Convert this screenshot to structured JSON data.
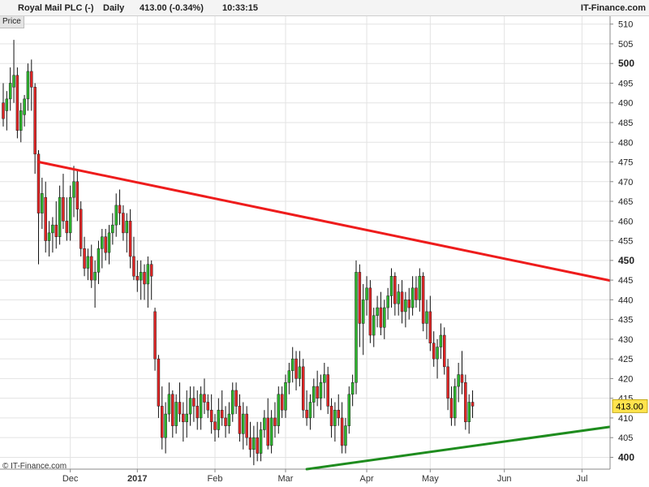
{
  "header": {
    "instrument": "Royal Mail PLC (-)",
    "period": "Daily",
    "quote": "413.00 (-0.34%)",
    "time": "10:33:15",
    "brand": "IT-Finance.com"
  },
  "price_tab": "Price",
  "footer": "© IT-Finance.com",
  "colors": {
    "up": "#2db52d",
    "down": "#e02525",
    "resistance": "#ee1c1c",
    "support": "#1e8c1e",
    "grid": "#e3e3e3",
    "axis": "#888888",
    "last_price_bg": "#ffe34d"
  },
  "chart_data": {
    "type": "candlestick",
    "title": "Royal Mail PLC (-)",
    "xlabel": "",
    "ylabel": "",
    "ylim": [
      397,
      512
    ],
    "grid": true,
    "y_ticks": [
      {
        "value": 400,
        "label": "400",
        "bold": true
      },
      {
        "value": 405,
        "label": "405",
        "bold": false
      },
      {
        "value": 410,
        "label": "410",
        "bold": false
      },
      {
        "value": 415,
        "label": "415",
        "bold": false
      },
      {
        "value": 420,
        "label": "420",
        "bold": false
      },
      {
        "value": 425,
        "label": "425",
        "bold": false
      },
      {
        "value": 430,
        "label": "430",
        "bold": false
      },
      {
        "value": 435,
        "label": "435",
        "bold": false
      },
      {
        "value": 440,
        "label": "440",
        "bold": false
      },
      {
        "value": 445,
        "label": "445",
        "bold": false
      },
      {
        "value": 450,
        "label": "450",
        "bold": true
      },
      {
        "value": 455,
        "label": "455",
        "bold": false
      },
      {
        "value": 460,
        "label": "460",
        "bold": false
      },
      {
        "value": 465,
        "label": "465",
        "bold": false
      },
      {
        "value": 470,
        "label": "470",
        "bold": false
      },
      {
        "value": 475,
        "label": "475",
        "bold": false
      },
      {
        "value": 480,
        "label": "480",
        "bold": false
      },
      {
        "value": 485,
        "label": "485",
        "bold": false
      },
      {
        "value": 490,
        "label": "490",
        "bold": false
      },
      {
        "value": 495,
        "label": "495",
        "bold": false
      },
      {
        "value": 500,
        "label": "500",
        "bold": true
      },
      {
        "value": 505,
        "label": "505",
        "bold": false
      },
      {
        "value": 510,
        "label": "510",
        "bold": false
      }
    ],
    "x_ticks": [
      {
        "index": 19,
        "label": "Dec",
        "bold": false
      },
      {
        "index": 38,
        "label": "2017",
        "bold": true
      },
      {
        "index": 60,
        "label": "Feb",
        "bold": false
      },
      {
        "index": 80,
        "label": "Mar",
        "bold": false
      },
      {
        "index": 103,
        "label": "Apr",
        "bold": false
      },
      {
        "index": 121,
        "label": "May",
        "bold": false
      },
      {
        "index": 142,
        "label": "Jun",
        "bold": false
      },
      {
        "index": 164,
        "label": "Jul",
        "bold": false
      }
    ],
    "last_price": {
      "value": 413.0,
      "label": "413.00"
    },
    "trendlines": [
      {
        "name": "resistance",
        "from": {
          "index": 10,
          "value": 475
        },
        "to": {
          "index": 174,
          "value": 444.5
        }
      },
      {
        "name": "support",
        "from": {
          "index": 86,
          "value": 397
        },
        "to": {
          "index": 174,
          "value": 408
        }
      }
    ],
    "candles": [
      [
        490,
        495,
        484,
        486
      ],
      [
        488,
        493,
        483,
        491
      ],
      [
        491,
        499,
        488,
        495
      ],
      [
        494,
        506,
        490,
        497
      ],
      [
        497,
        499,
        481,
        483
      ],
      [
        483,
        490,
        480,
        488
      ],
      [
        487,
        492,
        484,
        491
      ],
      [
        491,
        500,
        488,
        498
      ],
      [
        498,
        501,
        488,
        494
      ],
      [
        494,
        495,
        472,
        477
      ],
      [
        477,
        478,
        449,
        462
      ],
      [
        462,
        471,
        458,
        467
      ],
      [
        466,
        470,
        452,
        455
      ],
      [
        455,
        460,
        451,
        457
      ],
      [
        457,
        461,
        452,
        459
      ],
      [
        459,
        465,
        453,
        456
      ],
      [
        456,
        469,
        454,
        466
      ],
      [
        466,
        472,
        458,
        460
      ],
      [
        460,
        466,
        455,
        457
      ],
      [
        457,
        469,
        455,
        466
      ],
      [
        466,
        474,
        461,
        470
      ],
      [
        470,
        473,
        460,
        463
      ],
      [
        463,
        465,
        451,
        453
      ],
      [
        453,
        456,
        446,
        448
      ],
      [
        448,
        453,
        445,
        451
      ],
      [
        451,
        454,
        443,
        445
      ],
      [
        445,
        450,
        438,
        447
      ],
      [
        447,
        455,
        444,
        453
      ],
      [
        453,
        458,
        448,
        456
      ],
      [
        456,
        458,
        450,
        452
      ],
      [
        452,
        459,
        449,
        457
      ],
      [
        457,
        462,
        454,
        459
      ],
      [
        459,
        467,
        456,
        464
      ],
      [
        464,
        468,
        459,
        462
      ],
      [
        462,
        464,
        455,
        457
      ],
      [
        457,
        462,
        452,
        460
      ],
      [
        460,
        463,
        448,
        451
      ],
      [
        451,
        456,
        445,
        446
      ],
      [
        446,
        450,
        442,
        445
      ],
      [
        445,
        450,
        440,
        447
      ],
      [
        447,
        449,
        440,
        444
      ],
      [
        444,
        451,
        438,
        449
      ],
      [
        449,
        450,
        440,
        446
      ],
      [
        437,
        438,
        422,
        425
      ],
      [
        425,
        426,
        410,
        413
      ],
      [
        413,
        418,
        402,
        405
      ],
      [
        405,
        414,
        401,
        411
      ],
      [
        411,
        419,
        409,
        416
      ],
      [
        416,
        417,
        405,
        408
      ],
      [
        408,
        416,
        406,
        414
      ],
      [
        414,
        419,
        409,
        411
      ],
      [
        411,
        414,
        404,
        409
      ],
      [
        409,
        417,
        405,
        411
      ],
      [
        411,
        418,
        408,
        415
      ],
      [
        415,
        418,
        409,
        413
      ],
      [
        413,
        417,
        407,
        410
      ],
      [
        410,
        418,
        407,
        416
      ],
      [
        416,
        420,
        411,
        414
      ],
      [
        414,
        416,
        410,
        412
      ],
      [
        412,
        416,
        406,
        409
      ],
      [
        409,
        411,
        404,
        407
      ],
      [
        407,
        415,
        405,
        412
      ],
      [
        412,
        417,
        408,
        410
      ],
      [
        410,
        413,
        405,
        408
      ],
      [
        408,
        414,
        406,
        411
      ],
      [
        411,
        419,
        409,
        417
      ],
      [
        417,
        419,
        411,
        413
      ],
      [
        413,
        416,
        404,
        406
      ],
      [
        406,
        414,
        402,
        411
      ],
      [
        411,
        413,
        403,
        405
      ],
      [
        405,
        409,
        400,
        402
      ],
      [
        402,
        408,
        398,
        405
      ],
      [
        405,
        409,
        399,
        401
      ],
      [
        401,
        409,
        399,
        407
      ],
      [
        407,
        412,
        405,
        410
      ],
      [
        410,
        415,
        402,
        403
      ],
      [
        403,
        412,
        401,
        410
      ],
      [
        410,
        414,
        405,
        408
      ],
      [
        408,
        418,
        406,
        416
      ],
      [
        416,
        418,
        410,
        412
      ],
      [
        412,
        421,
        410,
        419
      ],
      [
        419,
        424,
        416,
        422
      ],
      [
        422,
        428,
        419,
        425
      ],
      [
        425,
        427,
        417,
        420
      ],
      [
        420,
        427,
        418,
        423
      ],
      [
        423,
        425,
        410,
        412
      ],
      [
        412,
        417,
        408,
        410
      ],
      [
        410,
        416,
        407,
        414
      ],
      [
        414,
        420,
        410,
        418
      ],
      [
        418,
        422,
        413,
        415
      ],
      [
        415,
        421,
        412,
        419
      ],
      [
        419,
        424,
        415,
        421
      ],
      [
        421,
        423,
        411,
        413
      ],
      [
        413,
        415,
        405,
        408
      ],
      [
        408,
        414,
        404,
        412
      ],
      [
        412,
        416,
        408,
        410
      ],
      [
        410,
        414,
        401,
        403
      ],
      [
        403,
        410,
        401,
        408
      ],
      [
        408,
        418,
        406,
        416
      ],
      [
        416,
        421,
        413,
        419
      ],
      [
        419,
        450,
        416,
        447
      ],
      [
        447,
        449,
        428,
        434
      ],
      [
        434,
        444,
        426,
        440
      ],
      [
        440,
        446,
        436,
        443
      ],
      [
        443,
        445,
        429,
        431
      ],
      [
        431,
        438,
        428,
        436
      ],
      [
        436,
        441,
        433,
        438
      ],
      [
        438,
        442,
        431,
        433
      ],
      [
        433,
        440,
        430,
        438
      ],
      [
        438,
        443,
        435,
        441
      ],
      [
        441,
        448,
        438,
        446
      ],
      [
        446,
        447,
        436,
        439
      ],
      [
        439,
        444,
        436,
        442
      ],
      [
        442,
        445,
        434,
        437
      ],
      [
        437,
        442,
        433,
        440
      ],
      [
        440,
        443,
        435,
        438
      ],
      [
        438,
        446,
        436,
        443
      ],
      [
        443,
        446,
        438,
        440
      ],
      [
        440,
        448,
        437,
        446
      ],
      [
        446,
        447,
        432,
        434
      ],
      [
        434,
        440,
        430,
        437
      ],
      [
        437,
        441,
        427,
        429
      ],
      [
        429,
        432,
        423,
        425
      ],
      [
        425,
        430,
        420,
        428
      ],
      [
        428,
        434,
        425,
        431
      ],
      [
        431,
        433,
        421,
        423
      ],
      [
        423,
        425,
        412,
        415
      ],
      [
        415,
        418,
        408,
        410
      ],
      [
        410,
        420,
        408,
        418
      ],
      [
        418,
        424,
        414,
        421
      ],
      [
        421,
        427,
        416,
        419
      ],
      [
        419,
        421,
        407,
        409
      ],
      [
        409,
        416,
        406,
        414
      ],
      [
        414,
        417,
        410,
        413
      ]
    ]
  }
}
